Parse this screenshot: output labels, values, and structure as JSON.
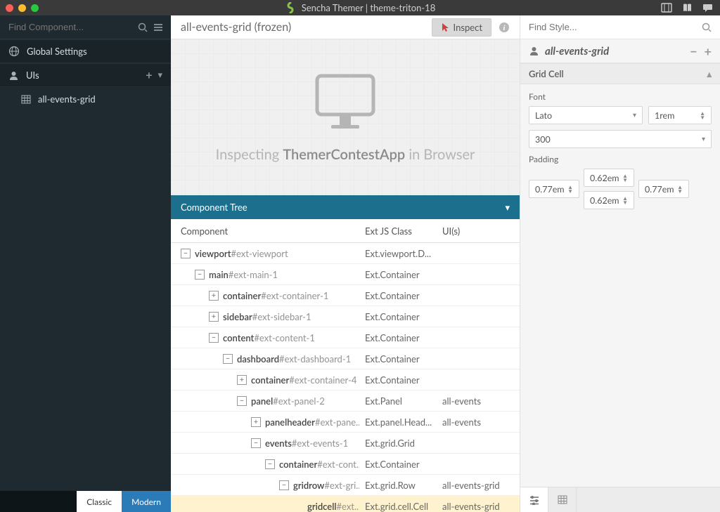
{
  "titlebar": {
    "app_name": "Sencha Themer",
    "theme_name": "theme-triton-18"
  },
  "sidebar": {
    "search_placeholder": "Find Component...",
    "global_settings": "Global Settings",
    "uis_label": "UIs",
    "items": [
      {
        "label": "all-events-grid"
      }
    ],
    "tabs": {
      "classic": "Classic",
      "modern": "Modern"
    }
  },
  "center": {
    "title": "all-events-grid (frozen)",
    "inspect_btn": "Inspect",
    "inspect_prefix": "Inspecting ",
    "inspect_app": "ThemerContestApp",
    "inspect_suffix": " in Browser",
    "tree_header": "Component Tree",
    "cols": {
      "component": "Component",
      "class": "Ext JS Class",
      "uis": "UI(s)"
    },
    "tree": [
      {
        "depth": 0,
        "toggle": "-",
        "name": "viewport",
        "id": "#ext-viewport",
        "class": "Ext.viewport.D...",
        "uis": "",
        "selected": false
      },
      {
        "depth": 1,
        "toggle": "-",
        "name": "main",
        "id": "#ext-main-1",
        "class": "Ext.Container",
        "uis": "",
        "selected": false
      },
      {
        "depth": 2,
        "toggle": "+",
        "name": "container",
        "id": "#ext-container-1",
        "class": "Ext.Container",
        "uis": "",
        "selected": false
      },
      {
        "depth": 2,
        "toggle": "+",
        "name": "sidebar",
        "id": "#ext-sidebar-1",
        "class": "Ext.Container",
        "uis": "",
        "selected": false
      },
      {
        "depth": 2,
        "toggle": "-",
        "name": "content",
        "id": "#ext-content-1",
        "class": "Ext.Container",
        "uis": "",
        "selected": false
      },
      {
        "depth": 3,
        "toggle": "-",
        "name": "dashboard",
        "id": "#ext-dashboard-1",
        "class": "Ext.Container",
        "uis": "",
        "selected": false
      },
      {
        "depth": 4,
        "toggle": "+",
        "name": "container",
        "id": "#ext-container-4",
        "class": "Ext.Container",
        "uis": "",
        "selected": false
      },
      {
        "depth": 4,
        "toggle": "-",
        "name": "panel",
        "id": "#ext-panel-2",
        "class": "Ext.Panel",
        "uis": "all-events",
        "selected": false
      },
      {
        "depth": 5,
        "toggle": "+",
        "name": "panelheader",
        "id": "#ext-pane...",
        "class": "Ext.panel.Head...",
        "uis": "all-events",
        "selected": false
      },
      {
        "depth": 5,
        "toggle": "-",
        "name": "events",
        "id": "#ext-events-1",
        "class": "Ext.grid.Grid",
        "uis": "",
        "selected": false
      },
      {
        "depth": 6,
        "toggle": "-",
        "name": "container",
        "id": "#ext-cont...",
        "class": "Ext.Container",
        "uis": "",
        "selected": false
      },
      {
        "depth": 7,
        "toggle": "-",
        "name": "gridrow",
        "id": "#ext-gri...",
        "class": "Ext.grid.Row",
        "uis": "all-events-grid",
        "selected": false
      },
      {
        "depth": 8,
        "toggle": "",
        "name": "gridcell",
        "id": "#ext...",
        "class": "Ext.grid.cell.Cell",
        "uis": "all-events-grid",
        "selected": true
      }
    ]
  },
  "right": {
    "search_placeholder": "Find Style...",
    "inspector_name": "all-events-grid",
    "section_gridcell": "Grid Cell",
    "font_label": "Font",
    "font_family": "Lato",
    "font_size": "1rem",
    "font_weight": "300",
    "padding_label": "Padding",
    "padding": {
      "top": "0.62em",
      "right": "0.77em",
      "bottom": "0.62em",
      "left": "0.77em"
    }
  }
}
